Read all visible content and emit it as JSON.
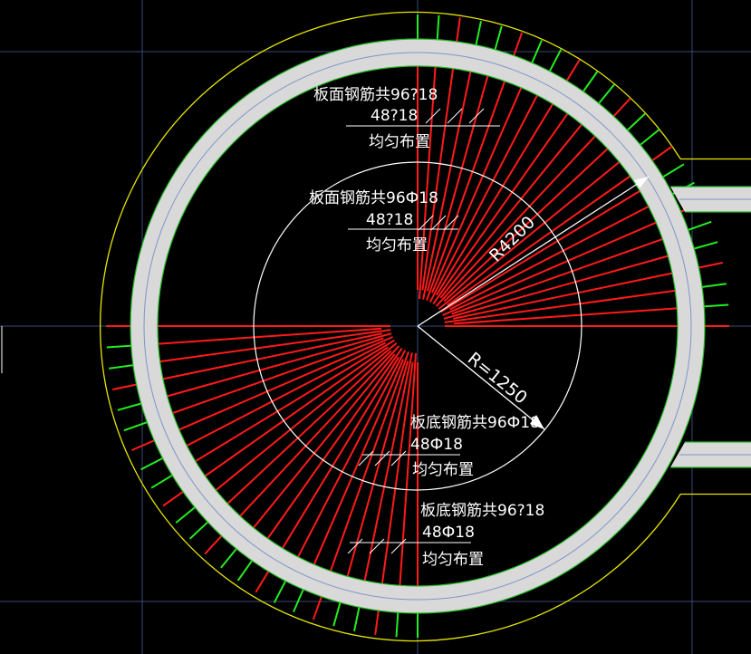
{
  "colors": {
    "background": "#000000",
    "grid": "#3a4a78",
    "wall_fill": "#d9d9d9",
    "wall_edge": "#22bb22",
    "axis_blue": "#7f94c8",
    "outline_yellow": "#e6e600",
    "bar_red": "#ff1a1a",
    "bar_green": "#22ee22",
    "white": "#ffffff"
  },
  "annotations": {
    "top_outer": {
      "line1": "板面钢筋共96?18",
      "line2": "48?18",
      "line3": "均匀布置"
    },
    "top_inner": {
      "line1": "板面钢筋共96Ф18",
      "line2": "48?18",
      "line3": "均匀布置"
    },
    "bottom_inner": {
      "line1": "板底钢筋共96Ф18",
      "line2": "48Ф18",
      "line3": "均匀布置"
    },
    "bottom_outer": {
      "line1": "板底钢筋共96?18",
      "line2": "48Ф18",
      "line3": "均匀布置"
    }
  },
  "dimensions": {
    "outer_radius": "R4200",
    "inner_radius": "R=1250"
  }
}
